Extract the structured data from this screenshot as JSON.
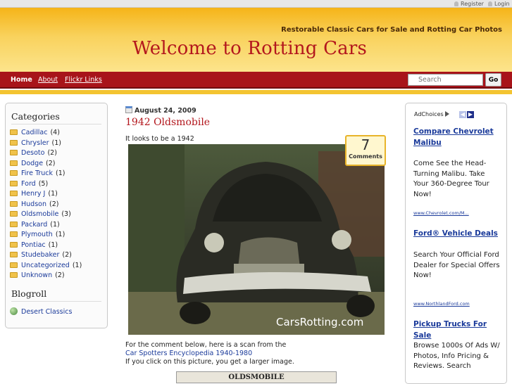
{
  "top_links": {
    "register": "Register",
    "login": "Login"
  },
  "header": {
    "tagline": "Restorable Classic Cars for Sale and Rotting Car Photos",
    "title": "Welcome to Rotting Cars"
  },
  "nav": {
    "home": "Home",
    "about": "About",
    "flickr": "Flickr Links"
  },
  "search": {
    "placeholder": "Search",
    "go": "Go"
  },
  "sidebar": {
    "categories_title": "Categories",
    "categories": [
      {
        "name": "Cadillac",
        "count": "(4)"
      },
      {
        "name": "Chrysler",
        "count": "(1)"
      },
      {
        "name": "Desoto",
        "count": "(2)"
      },
      {
        "name": "Dodge",
        "count": "(2)"
      },
      {
        "name": "Fire Truck",
        "count": "(1)"
      },
      {
        "name": "Ford",
        "count": "(5)"
      },
      {
        "name": "Henry J",
        "count": "(1)"
      },
      {
        "name": "Hudson",
        "count": "(2)"
      },
      {
        "name": "Oldsmobile",
        "count": "(3)"
      },
      {
        "name": "Packard",
        "count": "(1)"
      },
      {
        "name": "Plymouth",
        "count": "(1)"
      },
      {
        "name": "Pontiac",
        "count": "(1)"
      },
      {
        "name": "Studebaker",
        "count": "(2)"
      },
      {
        "name": "Uncategorized",
        "count": "(1)"
      },
      {
        "name": "Unknown",
        "count": "(2)"
      }
    ],
    "blogroll_title": "Blogroll",
    "blogroll": [
      {
        "name": "Desert Classics"
      }
    ]
  },
  "post": {
    "date": "August 24, 2009",
    "title": "1942 Oldsmobile",
    "intro": "It looks to be a 1942",
    "comments_count": "7",
    "comments_label": "Comments",
    "photo_watermark": "CarsRotting.com",
    "line1": "For the comment below, here is a scan from the",
    "link": "Car Spotters Encyclopedia 1940-1980",
    "line3": "If you click on this picture, you get a larger image.",
    "scan_label": "OLDSMOBILE"
  },
  "ads": {
    "adchoices": "AdChoices",
    "items": [
      {
        "title": "Compare Chevrolet Malibu",
        "body": "Come See the Head-Turning Malibu. Take Your 360-Degree Tour Now!",
        "url": "www.Chevrolet.com/M..."
      },
      {
        "title": "Ford® Vehicle Deals",
        "body": "Search Your Official Ford Dealer for Special Offers Now!",
        "url": "www.NorthlandFord.com"
      },
      {
        "title": "Pickup Trucks For Sale",
        "body": "Browse 1000s Of Ads W/ Photos, Info Pricing & Reviews. Search",
        "url": ""
      }
    ]
  },
  "colors": {
    "nav_red": "#a8141a",
    "title_red": "#b3171d",
    "header_gold": "#f5b418",
    "link_blue": "#1a3a9a"
  }
}
